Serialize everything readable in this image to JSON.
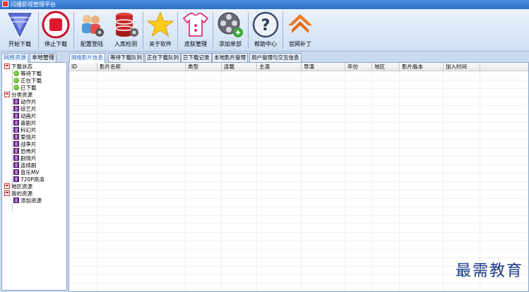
{
  "window": {
    "title": "闪播影视管理平台"
  },
  "toolbar": {
    "buttons": [
      {
        "label": "开始下载",
        "icon": "download-arrow-icon"
      },
      {
        "label": "停止下载",
        "icon": "stop-icon"
      },
      {
        "label": "配置登陆",
        "icon": "users-config-icon"
      },
      {
        "label": "入库检测",
        "icon": "database-icon"
      },
      {
        "label": "关于软件",
        "icon": "star-icon"
      },
      {
        "label": "皮肤管理",
        "icon": "skin-shirt-icon"
      },
      {
        "label": "添加单部",
        "icon": "add-film-reel-icon"
      },
      {
        "label": "帮助中心",
        "icon": "help-icon"
      },
      {
        "label": "官网补丁",
        "icon": "home-icon"
      }
    ]
  },
  "left_tabs": [
    "网络资源",
    "本地管理"
  ],
  "tree": {
    "download_status": {
      "label": "下载状态",
      "children": [
        "等待下载",
        "正在下载",
        "已下载"
      ]
    },
    "categories": {
      "label": "分类资源",
      "children": [
        "动作片",
        "综艺片",
        "动画片",
        "喜剧片",
        "科幻片",
        "爱情片",
        "战争片",
        "恐怖片",
        "剧情片",
        "连续剧",
        "音乐MV",
        "720P高清"
      ]
    },
    "region": {
      "label": "地区资源"
    },
    "mine": {
      "label": "我的资源",
      "children": [
        "添加资源"
      ]
    }
  },
  "main_tabs": [
    "网络影片信息",
    "等待下载队列",
    "正在下载队列",
    "已下载记录",
    "本地影片管理",
    "用户管理与交互信息"
  ],
  "table": {
    "columns": [
      "ID",
      "影片名称",
      "类型",
      "连载",
      "主演",
      "导演",
      "年份",
      "地区",
      "影片版本",
      "加入时间"
    ]
  },
  "watermark": "最需教育",
  "colors": {
    "accent": "#1a5fc0",
    "titlebar": "#2d6fc8",
    "background": "#c9daf0"
  }
}
